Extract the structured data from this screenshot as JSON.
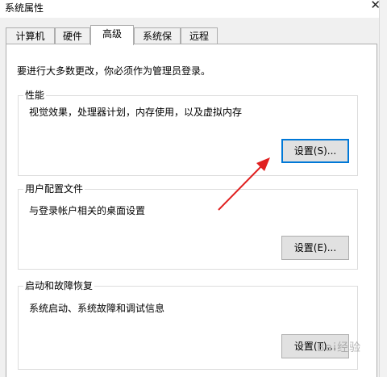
{
  "window": {
    "title": "系统属性"
  },
  "tabs": [
    {
      "label": "计算机名"
    },
    {
      "label": "硬件"
    },
    {
      "label": "高级",
      "active": true
    },
    {
      "label": "系统保护"
    },
    {
      "label": "远程"
    }
  ],
  "notice": "要进行大多数更改，你必须作为管理员登录。",
  "groups": {
    "performance": {
      "title": "性能",
      "desc": "视觉效果，处理器计划，内存使用，以及虚拟内存",
      "button": "设置(S)..."
    },
    "user_profiles": {
      "title": "用户配置文件",
      "desc": "与登录帐户相关的桌面设置",
      "button": "设置(E)..."
    },
    "startup_recovery": {
      "title": "启动和故障恢复",
      "desc": "系统启动、系统故障和调试信息",
      "button": "设置(T)..."
    }
  },
  "annotation": {
    "arrow_color": "#e02020"
  },
  "watermark": "Bai经验"
}
